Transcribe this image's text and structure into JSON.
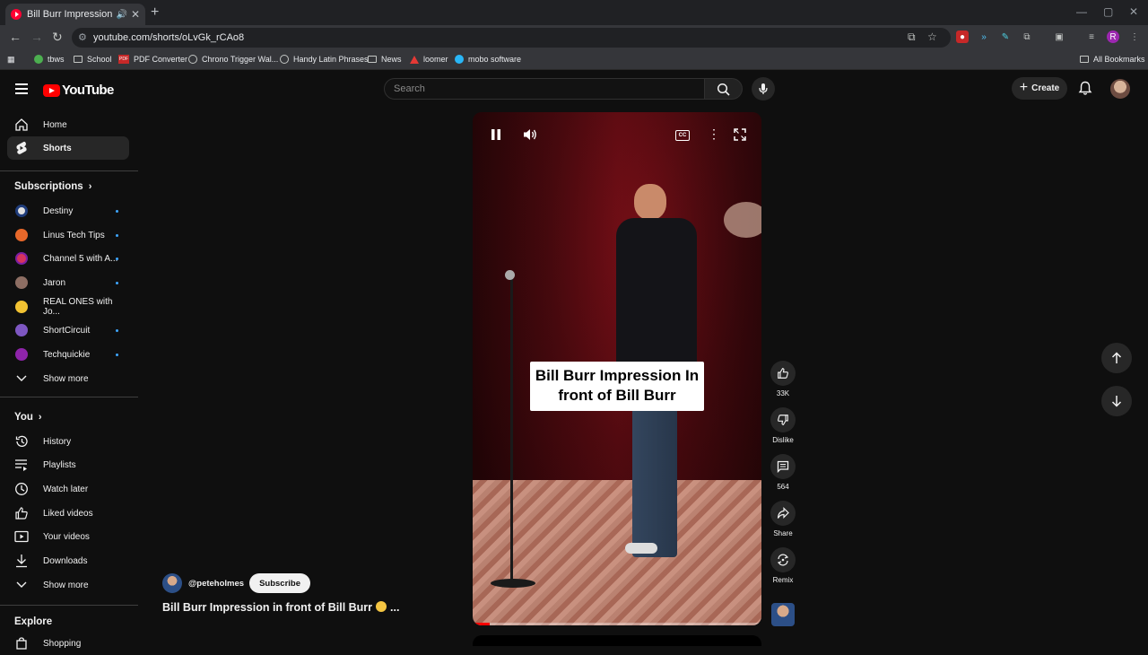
{
  "browser": {
    "tab_title": "Bill Burr Impression in front of Bill Burr",
    "url": "youtube.com/shorts/oLvGk_rCAo8",
    "bookmarks": [
      "tbws",
      "School",
      "PDF Converter",
      "Chrono Trigger Wal...",
      "Handy Latin Phrases",
      "News",
      "loomer",
      "mobo software"
    ],
    "all_bookmarks": "All Bookmarks"
  },
  "header": {
    "logo": "YouTube",
    "search_placeholder": "Search",
    "create_label": "Create"
  },
  "sidebar": {
    "main": [
      {
        "label": "Home",
        "icon": "home-icon"
      },
      {
        "label": "Shorts",
        "icon": "shorts-icon",
        "active": true
      }
    ],
    "subscriptions_title": "Subscriptions",
    "subscriptions": [
      {
        "label": "Destiny",
        "color": "#e0e0e0"
      },
      {
        "label": "Linus Tech Tips",
        "color": "#e8682a"
      },
      {
        "label": "Channel 5 with A...",
        "color": "#d6335e"
      },
      {
        "label": "Jaron",
        "color": "#8d6e63"
      },
      {
        "label": "REAL ONES with Jo...",
        "color": "#f1c232"
      },
      {
        "label": "ShortCircuit",
        "color": "#7e57c2"
      },
      {
        "label": "Techquickie",
        "color": "#8e24aa"
      }
    ],
    "show_more": "Show more",
    "you_title": "You",
    "you_items": [
      {
        "label": "History",
        "icon": "history-icon"
      },
      {
        "label": "Playlists",
        "icon": "playlists-icon"
      },
      {
        "label": "Watch later",
        "icon": "watch-later-icon"
      },
      {
        "label": "Liked videos",
        "icon": "liked-videos-icon"
      },
      {
        "label": "Your videos",
        "icon": "your-videos-icon"
      },
      {
        "label": "Downloads",
        "icon": "downloads-icon"
      }
    ],
    "show_more_2": "Show more",
    "explore_title": "Explore",
    "explore_items": [
      {
        "label": "Shopping",
        "icon": "shopping-icon"
      }
    ]
  },
  "short": {
    "caption": "Bill Burr Impression In front of Bill Burr",
    "channel": "@peteholmes",
    "subscribe_label": "Subscribe",
    "title": "Bill Burr Impression in front of Bill Burr",
    "title_suffix": "...",
    "likes": "33K",
    "dislike_label": "Dislike",
    "comments": "564",
    "share_label": "Share",
    "remix_label": "Remix",
    "progress": 0.06
  }
}
